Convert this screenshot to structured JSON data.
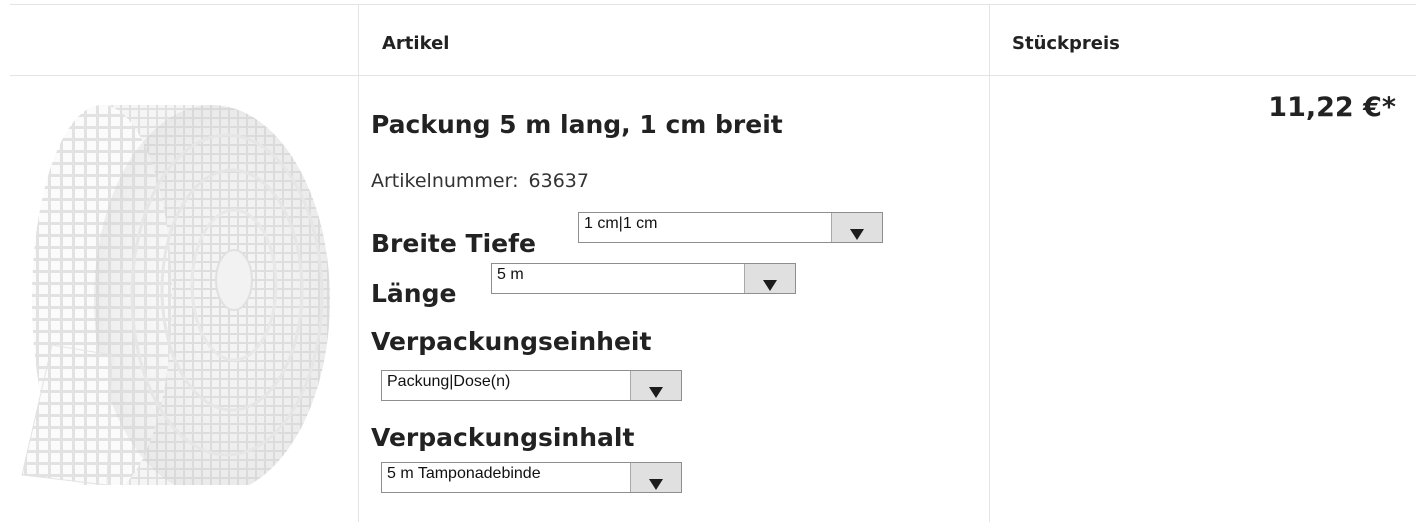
{
  "table": {
    "headers": {
      "image": "",
      "article": "Artikel",
      "unit_price": "Stückpreis"
    }
  },
  "product": {
    "image_alt": "roll-of-white-mesh-bandage",
    "title": "Packung 5 m lang, 1 cm breit",
    "article_number_label": "Artikelnummer:",
    "article_number": "63637",
    "price": "11,22 €*",
    "options": [
      {
        "label": "Breite Tiefe",
        "selected": "1 cm|1 cm"
      },
      {
        "label": "Länge",
        "selected": "5 m"
      },
      {
        "label": "Verpackungseinheit",
        "selected": "Packung|Dose(n)"
      },
      {
        "label": "Verpackungsinhalt",
        "selected": "5 m Tamponadebinde"
      }
    ]
  },
  "colors": {
    "border": "#e4e4e4",
    "select_button": "#e0e0e0",
    "text": "#222222"
  },
  "icons": {
    "dropdown": "triangle-down-icon"
  }
}
